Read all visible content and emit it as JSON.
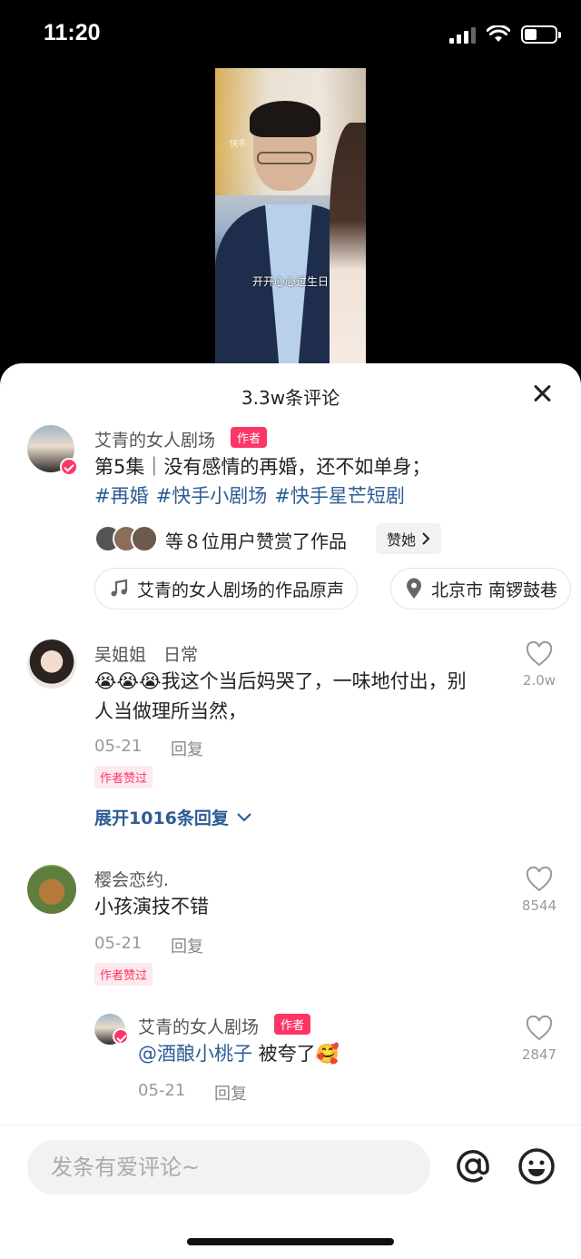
{
  "status_bar": {
    "time": "11:20"
  },
  "video": {
    "watermark": "快手",
    "subtitle": "开开心心过生日"
  },
  "sheet": {
    "title": "3.3w条评论",
    "post": {
      "author": "艾青的女人剧场",
      "author_tag": "作者",
      "text": "第5集｜没有感情的再婚，还不如单身；",
      "hashtags": [
        "#再婚",
        "#快手小剧场",
        "#快手星芒短剧"
      ],
      "likers_text": "等８位用户赞赏了作品",
      "praise_button": "赞她",
      "music_chip": "艾青的女人剧场的作品原声",
      "location_chip": "北京市 南锣鼓巷"
    },
    "comments": [
      {
        "name": "吴姐姐",
        "badge": "日常",
        "emojis": "😭😭😭",
        "text_line1": "我这个当后妈哭了，一味地付出，别",
        "text_line2": "人当做理所当然，",
        "date": "05-21",
        "reply": "回复",
        "liked_tag": "作者赞过",
        "likes": "2.0w",
        "expand": "展开1016条回复"
      },
      {
        "name": "樱会恋约.",
        "text": "小孩演技不错",
        "date": "05-21",
        "reply": "回复",
        "liked_tag": "作者赞过",
        "likes": "8544"
      },
      {
        "name": "艾青的女人剧场",
        "author_tag": "作者",
        "mention": "@酒酿小桃子",
        "text": " 被夸了🥰",
        "date": "05-21",
        "reply": "回复",
        "likes": "2847"
      }
    ]
  },
  "input_bar": {
    "placeholder": "发条有爱评论~"
  }
}
